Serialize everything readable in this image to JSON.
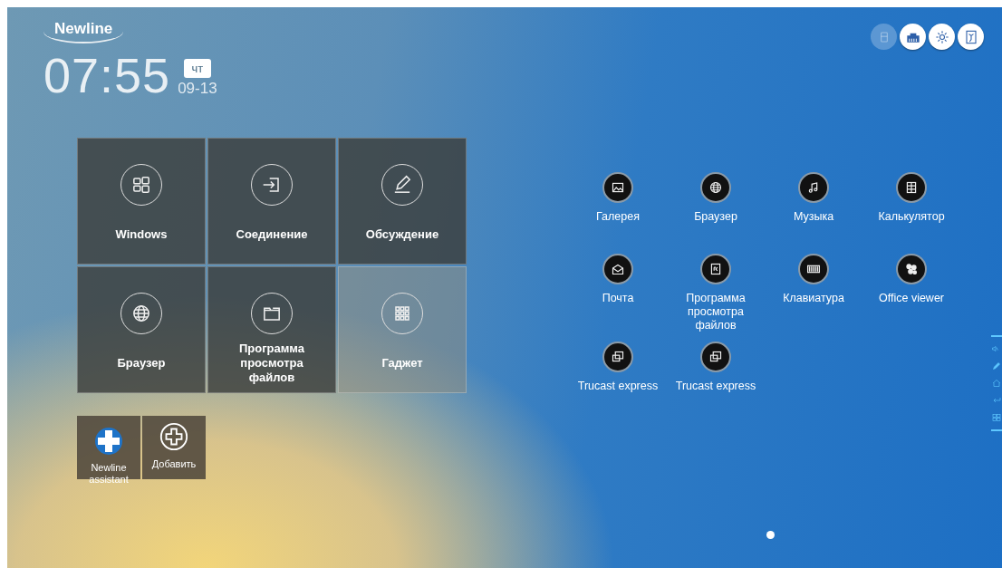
{
  "brand": {
    "logo": "Newline"
  },
  "clock": {
    "time": "07:55",
    "weekday": "чт",
    "date": "09-13"
  },
  "tiles": [
    {
      "label": "Windows"
    },
    {
      "label": "Соединение"
    },
    {
      "label": "Обсуждение"
    },
    {
      "label": "Браузер"
    },
    {
      "label": "Программа просмотра файлов"
    },
    {
      "label": "Гаджет"
    }
  ],
  "shortcuts": [
    {
      "label": "Newline assistant",
      "kind": "app"
    },
    {
      "label": "Добавить",
      "kind": "add"
    }
  ],
  "apps": [
    {
      "label": "Галерея"
    },
    {
      "label": "Браузер"
    },
    {
      "label": "Музыка"
    },
    {
      "label": "Калькулятор"
    },
    {
      "label": "Почта"
    },
    {
      "label": "Программа просмотра файлов"
    },
    {
      "label": "Клавиатура"
    },
    {
      "label": "Office viewer"
    },
    {
      "label": "Trucast express"
    },
    {
      "label": "Trucast express"
    }
  ],
  "pager": [
    {
      "selected": true
    }
  ]
}
